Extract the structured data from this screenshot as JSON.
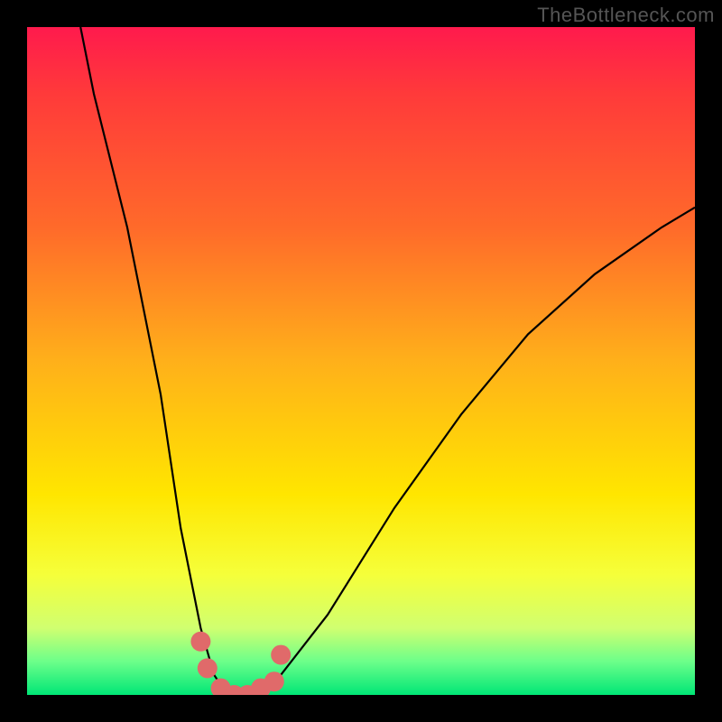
{
  "watermark": "TheBottleneck.com",
  "chart_data": {
    "type": "line",
    "title": "",
    "xlabel": "",
    "ylabel": "",
    "xlim": [
      0,
      100
    ],
    "ylim": [
      0,
      100
    ],
    "background_gradient": {
      "direction": "vertical",
      "stops": [
        {
          "pos": 0,
          "color": "#ff1a4d",
          "meaning": "severe bottleneck"
        },
        {
          "pos": 50,
          "color": "#ffe600",
          "meaning": "moderate"
        },
        {
          "pos": 100,
          "color": "#00e676",
          "meaning": "balanced"
        }
      ]
    },
    "series": [
      {
        "name": "bottleneck-curve",
        "color": "#000000",
        "x": [
          8,
          10,
          15,
          20,
          23,
          26,
          28,
          30,
          33,
          38,
          45,
          55,
          65,
          75,
          85,
          95,
          100
        ],
        "y": [
          100,
          90,
          70,
          45,
          25,
          10,
          3,
          0,
          0,
          3,
          12,
          28,
          42,
          54,
          63,
          70,
          73
        ]
      },
      {
        "name": "highlight-dots",
        "color": "#e06a6a",
        "type": "scatter",
        "x": [
          26,
          27,
          29,
          31,
          33,
          35,
          37,
          38
        ],
        "y": [
          8,
          4,
          1,
          0,
          0,
          1,
          2,
          6
        ]
      }
    ],
    "optimal_x": 31
  }
}
